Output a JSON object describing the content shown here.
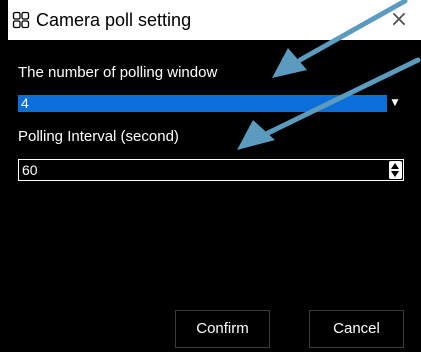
{
  "dialog": {
    "title": "Camera poll setting",
    "close_glyph": "×",
    "title_icon": "four-windows-icon"
  },
  "form": {
    "windows_label": "The number of polling window",
    "windows_value": "4",
    "interval_label": "Polling Interval (second)",
    "interval_value": "60"
  },
  "buttons": {
    "confirm": "Confirm",
    "cancel": "Cancel"
  },
  "colors": {
    "background": "#000000",
    "titlebar": "#ffffff",
    "select_highlight": "#0c6fd9",
    "annotation_arrow": "#5b9bbd"
  }
}
